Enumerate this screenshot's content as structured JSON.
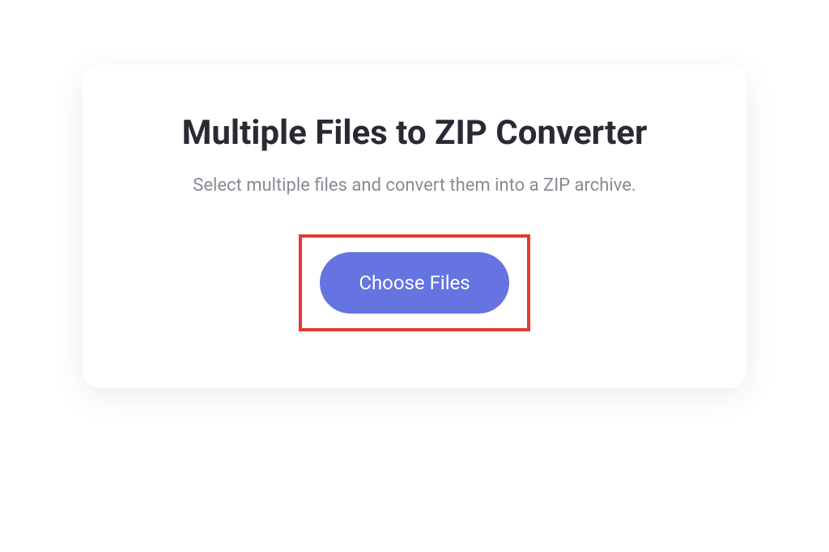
{
  "card": {
    "title": "Multiple Files to ZIP Converter",
    "subtitle": "Select multiple files and convert them into a ZIP archive.",
    "choose_button_label": "Choose Files"
  },
  "colors": {
    "accent": "#6574e0",
    "highlight_border": "#e53935",
    "title_text": "#2a2a35",
    "subtitle_text": "#8a8a95"
  }
}
